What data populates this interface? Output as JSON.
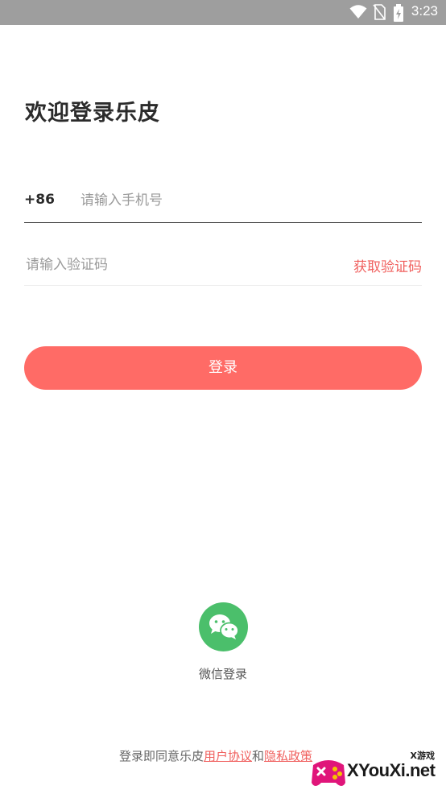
{
  "status_bar": {
    "time": "3:23",
    "icons": [
      "wifi-icon",
      "no-sim-icon",
      "battery-charging-icon"
    ],
    "background": "#9e9e9e"
  },
  "title": "欢迎登录乐皮",
  "phone": {
    "country_code": "+86",
    "placeholder": "请输入手机号"
  },
  "verification": {
    "placeholder": "请输入验证码",
    "get_code_label": "获取验证码"
  },
  "login_button": {
    "label": "登录",
    "color": "#ff6b66"
  },
  "wechat_login": {
    "label": "微信登录",
    "icon": "wechat-icon",
    "color": "#4bbf6b"
  },
  "agreement": {
    "prefix": "登录即同意乐皮",
    "user_agreement": "用户协议",
    "and": "和",
    "privacy_policy": "隐私政策"
  },
  "watermark": {
    "cn": "X游戏",
    "text": "XYouXi.net"
  },
  "accent_color": "#f0605e"
}
